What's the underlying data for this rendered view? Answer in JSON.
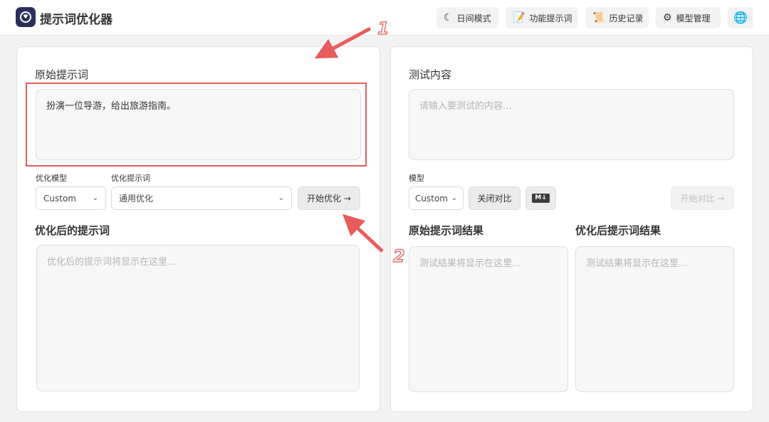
{
  "header": {
    "app_title": "提示词优化器",
    "nav": [
      {
        "label": "日间模式",
        "icon": "moon-icon"
      },
      {
        "label": "功能提示词",
        "icon": "note-icon"
      },
      {
        "label": "历史记录",
        "icon": "scroll-icon"
      },
      {
        "label": "模型管理",
        "icon": "gear-icon"
      },
      {
        "label": "",
        "icon": "globe-icon"
      }
    ]
  },
  "left": {
    "original_title": "原始提示词",
    "original_value": "扮演一位导游，给出旅游指南。",
    "model_label": "优化模型",
    "model_value": "Custom",
    "template_label": "优化提示词",
    "template_value": "通用优化",
    "optimize_button": "开始优化 →",
    "optimized_title": "优化后的提示词",
    "optimized_placeholder": "优化后的提示词将显示在这里..."
  },
  "right": {
    "test_title": "测试内容",
    "test_placeholder": "请输入要测试的内容...",
    "model_label": "模型",
    "model_value": "Custom",
    "compare_button": "关闭对比",
    "markdown_badge": "M↓",
    "start_compare_button": "开始对比 →",
    "original_result_title": "原始提示词结果",
    "optimized_result_title": "优化后提示词结果",
    "result_placeholder": "测试结果将显示在这里..."
  },
  "annotations": {
    "step1": "1",
    "step2": "2",
    "color": "#e85c5c"
  }
}
